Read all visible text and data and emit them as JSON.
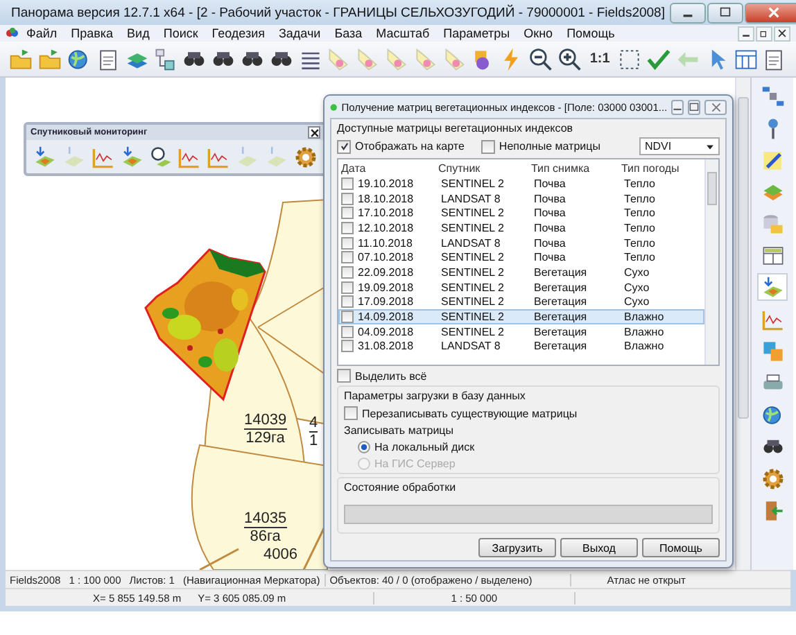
{
  "window": {
    "title": "Панорама версия 12.7.1 x64 - [2 - Рабочий участок - ГРАНИЦЫ СЕЛЬХОЗУГОДИЙ - 79000001 - Fields2008]"
  },
  "menu": [
    "Файл",
    "Правка",
    "Вид",
    "Поиск",
    "Геодезия",
    "Задачи",
    "База",
    "Масштаб",
    "Параметры",
    "Окно",
    "Помощь"
  ],
  "toolbar": {
    "scale_button": "1:1"
  },
  "satellite_toolbar": {
    "title": "Спутниковый мониторинг"
  },
  "map": {
    "fields": [
      {
        "number": "14039",
        "area": "129га"
      },
      {
        "number": "14035",
        "area": "86га"
      },
      {
        "number": "4",
        "area": "1"
      },
      {
        "number": "4006"
      }
    ]
  },
  "dialog": {
    "title": "Получение матриц вегетационных индексов - [Поле: 03000 03001...",
    "group_title": "Доступные матрицы вегетационных индексов",
    "show_on_map": {
      "label": "Отображать на карте",
      "checked": true
    },
    "incomplete": {
      "label": "Неполные матрицы",
      "checked": false
    },
    "index_select": {
      "value": "NDVI"
    },
    "table": {
      "columns": [
        "Дата",
        "Спутник",
        "Тип снимка",
        "Тип погоды"
      ],
      "rows": [
        {
          "cells": [
            "19.10.2018",
            "SENTINEL 2",
            "Почва",
            "Тепло"
          ],
          "checked": false,
          "selected": false
        },
        {
          "cells": [
            "18.10.2018",
            "LANDSAT 8",
            "Почва",
            "Тепло"
          ],
          "checked": false,
          "selected": false
        },
        {
          "cells": [
            "17.10.2018",
            "SENTINEL 2",
            "Почва",
            "Тепло"
          ],
          "checked": false,
          "selected": false
        },
        {
          "cells": [
            "12.10.2018",
            "SENTINEL 2",
            "Почва",
            "Тепло"
          ],
          "checked": false,
          "selected": false
        },
        {
          "cells": [
            "11.10.2018",
            "LANDSAT 8",
            "Почва",
            "Тепло"
          ],
          "checked": false,
          "selected": false
        },
        {
          "cells": [
            "07.10.2018",
            "SENTINEL 2",
            "Почва",
            "Тепло"
          ],
          "checked": false,
          "selected": false
        },
        {
          "cells": [
            "22.09.2018",
            "SENTINEL 2",
            "Вегетация",
            "Сухо"
          ],
          "checked": false,
          "selected": false
        },
        {
          "cells": [
            "19.09.2018",
            "SENTINEL 2",
            "Вегетация",
            "Сухо"
          ],
          "checked": false,
          "selected": false
        },
        {
          "cells": [
            "17.09.2018",
            "SENTINEL 2",
            "Вегетация",
            "Сухо"
          ],
          "checked": false,
          "selected": false
        },
        {
          "cells": [
            "14.09.2018",
            "SENTINEL 2",
            "Вегетация",
            "Влажно"
          ],
          "checked": false,
          "selected": true
        },
        {
          "cells": [
            "04.09.2018",
            "SENTINEL 2",
            "Вегетация",
            "Влажно"
          ],
          "checked": false,
          "selected": false
        },
        {
          "cells": [
            "31.08.2018",
            "LANDSAT 8",
            "Вегетация",
            "Влажно"
          ],
          "checked": false,
          "selected": false
        }
      ]
    },
    "select_all": {
      "label": "Выделить всё",
      "checked": false
    },
    "load_params": {
      "title": "Параметры загрузки в базу данных",
      "overwrite": {
        "label": "Перезаписывать существующие матрицы",
        "checked": false
      },
      "write_label": "Записывать матрицы",
      "targets": [
        {
          "label": "На локальный диск",
          "selected": true,
          "disabled": false
        },
        {
          "label": "На ГИС Сервер",
          "selected": false,
          "disabled": true
        }
      ]
    },
    "status": {
      "title": "Состояние обработки",
      "level": 0
    },
    "buttons": [
      "Загрузить",
      "Выход",
      "Помощь"
    ]
  },
  "status_bar": {
    "row_1": [
      "Fields2008",
      "1 : 100 000",
      "Листов: 1",
      "(Навигационная Меркатора)",
      "Объектов: 40 / 0 (отображено / выделено)",
      "Атлас не открыт"
    ],
    "row_2": [
      "X= 5 855 149.58 m",
      "Y= 3 605 085.09 m",
      "1 : 50 000"
    ]
  }
}
